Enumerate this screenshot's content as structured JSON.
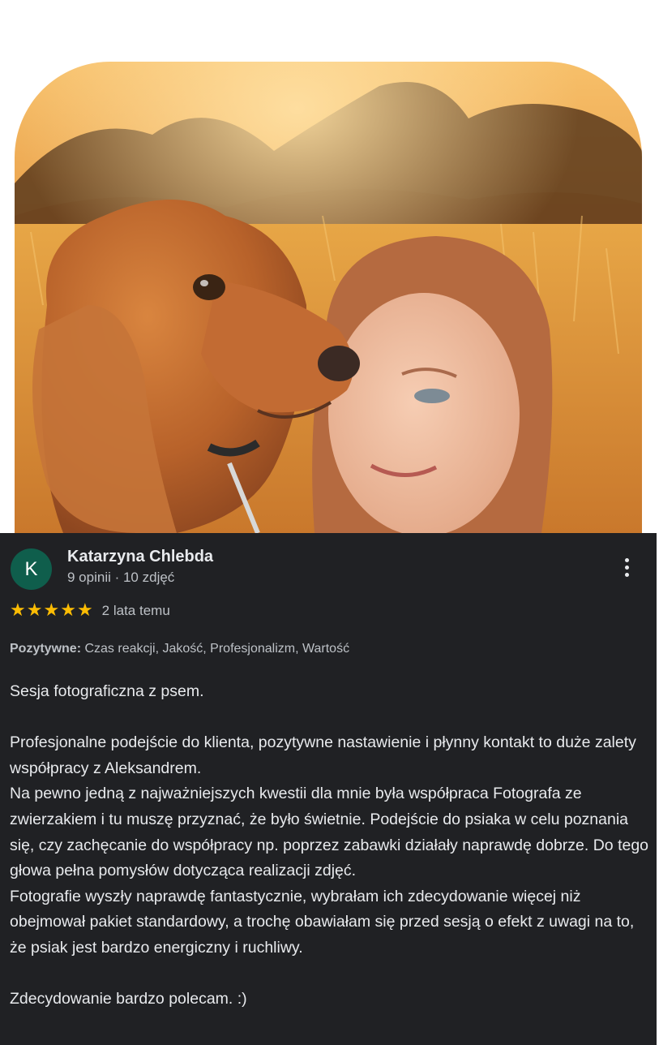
{
  "photo": {
    "description_icon": "review-photo"
  },
  "review": {
    "avatar_letter": "K",
    "reviewer_name": "Katarzyna Chlebda",
    "reviewer_meta": "9 opinii · 10 zdjęć",
    "rating": 5,
    "rating_max": 5,
    "date": "2 lata temu",
    "attributes_label": "Pozytywne:",
    "attributes_value": " Czas reakcji, Jakość, Profesjonalizm, Wartość",
    "text": "Sesja fotograficzna z psem.\n\nProfesjonalne podejście do klienta, pozytywne nastawienie i płynny kontakt to duże zalety współpracy z Aleksandrem.\nNa pewno jedną z najważniejszych kwestii dla mnie była współpraca Fotografa ze zwierzakiem i tu muszę przyznać, że było świetnie. Podejście do psiaka w celu poznania się, czy zachęcanie do współpracy np. poprzez zabawki działały naprawdę dobrze. Do tego głowa pełna pomysłów dotycząca realizacji zdjęć.\nFotografie wyszły naprawdę fantastycznie, wybrałam ich zdecydowanie więcej niż obejmował pakiet standardowy, a trochę obawiałam się przed sesją o efekt z uwagi na to, że psiak jest bardzo energiczny i ruchliwy.\n\nZdecydowanie bardzo polecam. :)"
  },
  "colors": {
    "card_background": "#202124",
    "avatar_background": "#0f5e4c",
    "star": "#fbbc04"
  }
}
